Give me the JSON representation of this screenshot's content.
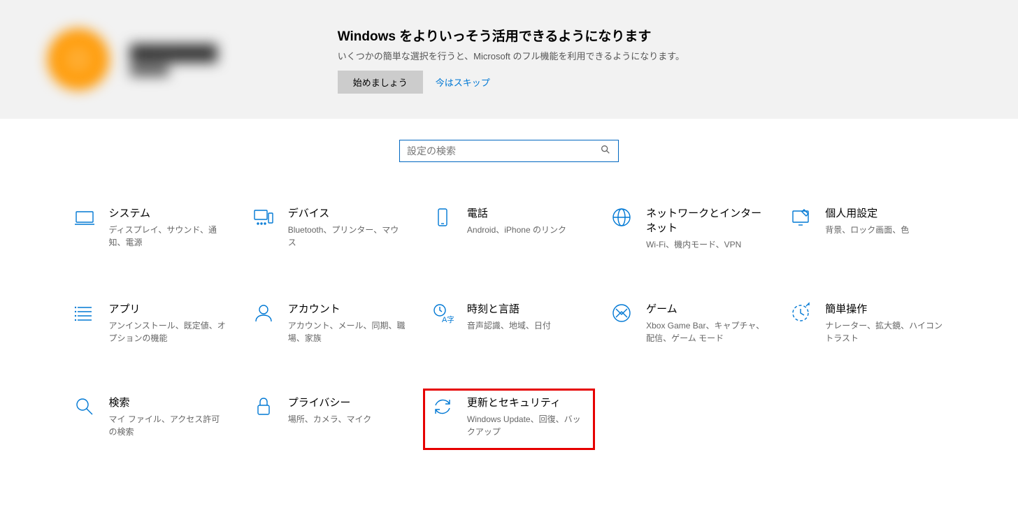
{
  "banner": {
    "title": "Windows をよりいっそう活用できるようになります",
    "subtitle": "いくつかの簡単な選択を行うと、Microsoft のフル機能を利用できるようになります。",
    "start_label": "始めましょう",
    "skip_label": "今はスキップ"
  },
  "search": {
    "placeholder": "設定の検索"
  },
  "tiles": [
    {
      "icon": "system",
      "title": "システム",
      "desc": "ディスプレイ、サウンド、通知、電源"
    },
    {
      "icon": "devices",
      "title": "デバイス",
      "desc": "Bluetooth、プリンター、マウス"
    },
    {
      "icon": "phone",
      "title": "電話",
      "desc": "Android、iPhone のリンク"
    },
    {
      "icon": "network",
      "title": "ネットワークとインターネット",
      "desc": "Wi-Fi、機内モード、VPN"
    },
    {
      "icon": "personal",
      "title": "個人用設定",
      "desc": "背景、ロック画面、色"
    },
    {
      "icon": "apps",
      "title": "アプリ",
      "desc": "アンインストール、既定値、オプションの機能"
    },
    {
      "icon": "accounts",
      "title": "アカウント",
      "desc": "アカウント、メール、同期、職場、家族"
    },
    {
      "icon": "time",
      "title": "時刻と言語",
      "desc": "音声認識、地域、日付"
    },
    {
      "icon": "gaming",
      "title": "ゲーム",
      "desc": "Xbox Game Bar、キャプチャ、配信、ゲーム モード"
    },
    {
      "icon": "ease",
      "title": "簡単操作",
      "desc": "ナレーター、拡大鏡、ハイコントラスト"
    },
    {
      "icon": "search",
      "title": "検索",
      "desc": "マイ ファイル、アクセス許可の検索"
    },
    {
      "icon": "privacy",
      "title": "プライバシー",
      "desc": "場所、カメラ、マイク"
    },
    {
      "icon": "update",
      "title": "更新とセキュリティ",
      "desc": "Windows Update、回復、バックアップ",
      "highlighted": true
    }
  ]
}
